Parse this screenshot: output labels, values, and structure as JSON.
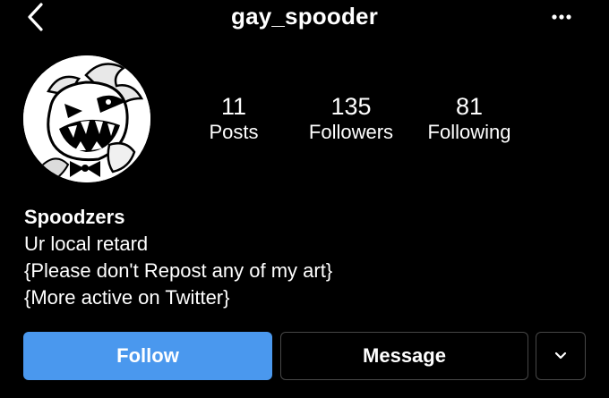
{
  "header": {
    "username": "gay_spooder"
  },
  "profile": {
    "avatar_icon": "cartoon-character-avatar",
    "stats": {
      "posts": {
        "value": "11",
        "label": "Posts"
      },
      "followers": {
        "value": "135",
        "label": "Followers"
      },
      "following": {
        "value": "81",
        "label": "Following"
      }
    },
    "bio": {
      "name": "Spoodzers",
      "lines": [
        "Ur local retard",
        "{Please don't Repost any of my art}",
        "{More active on Twitter}"
      ]
    }
  },
  "actions": {
    "follow_label": "Follow",
    "message_label": "Message"
  },
  "colors": {
    "background": "#000000",
    "follow_button": "#4a98ee",
    "outline_button_border": "#474747"
  }
}
